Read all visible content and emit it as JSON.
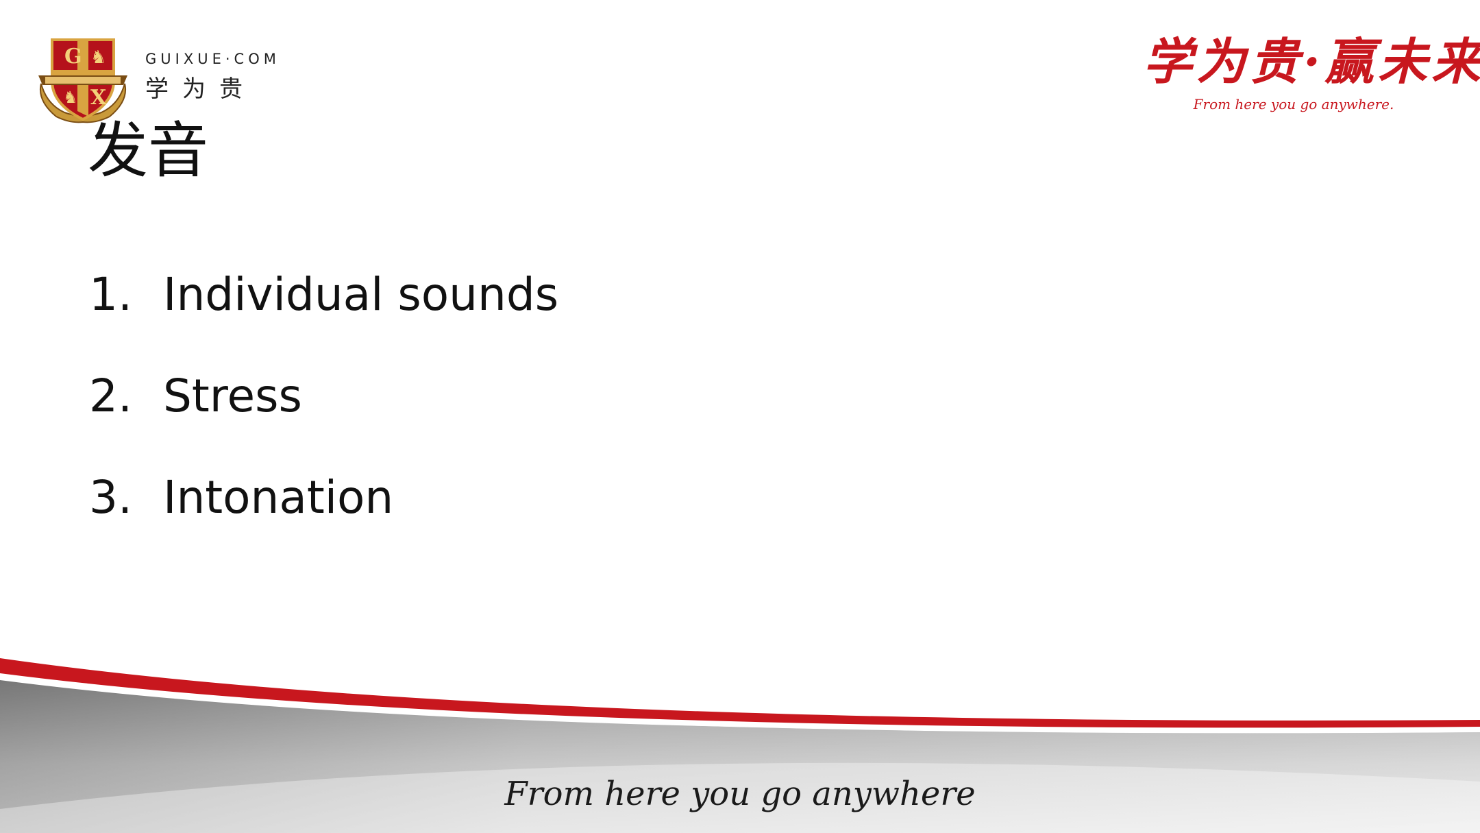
{
  "logo": {
    "domain": "GUIXUE·COM",
    "cn_name": "学为贵",
    "crest_colors": {
      "gold": "#d9a441",
      "red": "#b5121b",
      "dark": "#6b3a12"
    }
  },
  "slogan": {
    "cn": "学为贵·赢未来",
    "en": "From here you go anywhere.",
    "color": "#c8171e"
  },
  "title": "发音",
  "items": [
    {
      "num": "1.",
      "text": "Individual sounds"
    },
    {
      "num": "2.",
      "text": "Stress"
    },
    {
      "num": "3.",
      "text": "Intonation"
    }
  ],
  "footer": {
    "tagline": "From here you go anywhere",
    "accent": "#c8171e",
    "band_gray": "#8a8a8a"
  }
}
